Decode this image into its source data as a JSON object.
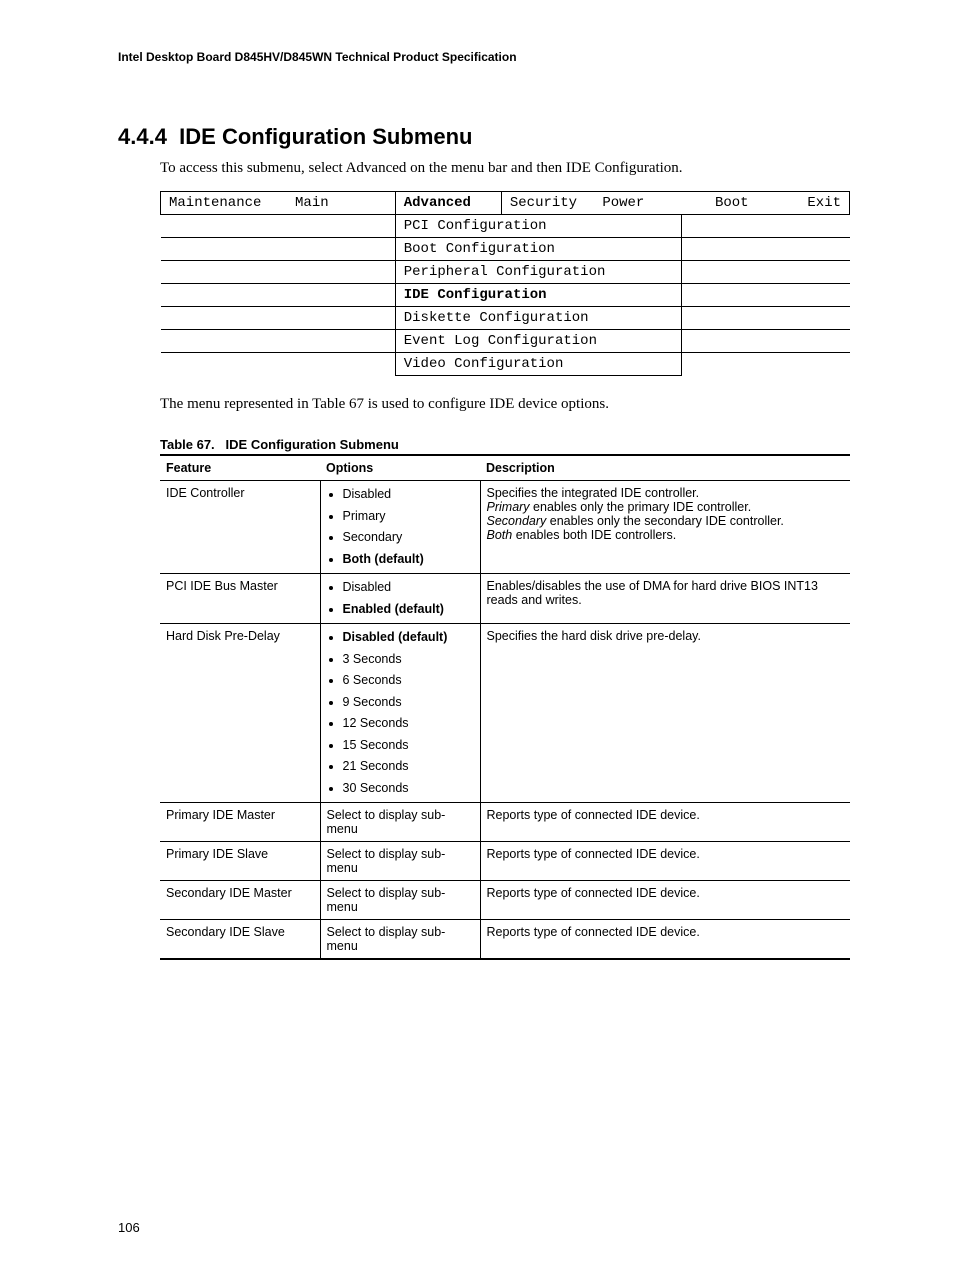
{
  "header": {
    "running": "Intel Desktop Board D845HV/D845WN Technical Product Specification"
  },
  "section": {
    "number": "4.4.4",
    "title": "IDE Configuration Submenu",
    "intro": "To access this submenu, select Advanced on the menu bar and then IDE Configuration."
  },
  "menu": {
    "top": [
      "Maintenance",
      "Main",
      "Advanced",
      "Security",
      "Power",
      "Boot",
      "Exit"
    ],
    "sub": [
      "PCI Configuration",
      "Boot Configuration",
      "Peripheral Configuration",
      "IDE Configuration",
      "Diskette Configuration",
      "Event Log Configuration",
      "Video Configuration"
    ],
    "active_sub": "IDE Configuration"
  },
  "between": "The menu represented in Table 67 is used to configure IDE device options.",
  "table": {
    "caption_num": "Table 67.",
    "caption_title": "IDE Configuration Submenu",
    "headers": [
      "Feature",
      "Options",
      "Description"
    ],
    "rows": [
      {
        "feature": "IDE Controller",
        "options": [
          {
            "text": "Disabled",
            "bold": false
          },
          {
            "text": "Primary",
            "bold": false
          },
          {
            "text": "Secondary",
            "bold": false
          },
          {
            "text": "Both (default)",
            "bold": true
          }
        ],
        "description_parts": [
          {
            "t": "Specifies the integrated IDE controller.",
            "br": true
          },
          {
            "t": "Primary",
            "i": true
          },
          {
            "t": " enables only the primary IDE controller.",
            "br": true
          },
          {
            "t": "Secondary",
            "i": true
          },
          {
            "t": " enables only the secondary IDE controller.",
            "br": true
          },
          {
            "t": "Both",
            "i": true
          },
          {
            "t": " enables both IDE controllers."
          }
        ]
      },
      {
        "feature": "PCI IDE Bus Master",
        "options": [
          {
            "text": "Disabled",
            "bold": false
          },
          {
            "text": "Enabled (default)",
            "bold": true
          }
        ],
        "description_parts": [
          {
            "t": "Enables/disables the use of DMA for hard drive BIOS INT13 reads and writes."
          }
        ]
      },
      {
        "feature": "Hard Disk Pre-Delay",
        "options": [
          {
            "text": "Disabled (default)",
            "bold": true
          },
          {
            "text": "3 Seconds",
            "bold": false
          },
          {
            "text": "6 Seconds",
            "bold": false
          },
          {
            "text": "9 Seconds",
            "bold": false
          },
          {
            "text": "12 Seconds",
            "bold": false
          },
          {
            "text": "15 Seconds",
            "bold": false
          },
          {
            "text": "21 Seconds",
            "bold": false
          },
          {
            "text": "30 Seconds",
            "bold": false
          }
        ],
        "description_parts": [
          {
            "t": "Specifies the hard disk drive pre-delay."
          }
        ]
      },
      {
        "feature": "Primary IDE Master",
        "options_text": "Select to display sub-menu",
        "description_parts": [
          {
            "t": "Reports type of connected IDE device."
          }
        ]
      },
      {
        "feature": "Primary IDE Slave",
        "options_text": "Select to display sub-menu",
        "description_parts": [
          {
            "t": "Reports type of connected IDE device."
          }
        ]
      },
      {
        "feature": "Secondary IDE Master",
        "options_text": "Select to display sub-menu",
        "description_parts": [
          {
            "t": "Reports type of connected IDE device."
          }
        ]
      },
      {
        "feature": "Secondary IDE Slave",
        "options_text": "Select to display sub-menu",
        "description_parts": [
          {
            "t": "Reports type of connected IDE device."
          }
        ]
      }
    ]
  },
  "page_number": "106"
}
